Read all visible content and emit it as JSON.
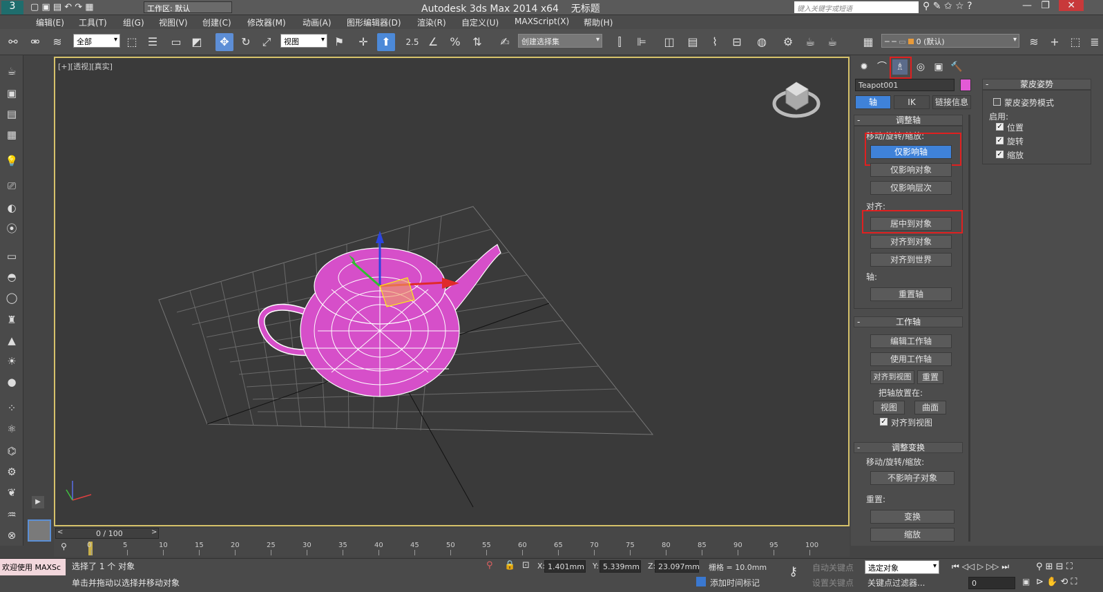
{
  "title": {
    "app": "Autodesk 3ds Max  2014 x64",
    "doc": "无标题",
    "workspace": "工作区: 默认",
    "search_placeholder": "键入关键字或短语"
  },
  "menu": [
    "编辑(E)",
    "工具(T)",
    "组(G)",
    "视图(V)",
    "创建(C)",
    "修改器(M)",
    "动画(A)",
    "图形编辑器(D)",
    "渲染(R)",
    "自定义(U)",
    "MAXScript(X)",
    "帮助(H)"
  ],
  "toolbar": {
    "filter": "全部",
    "refcoord": "视图",
    "snap_angle": "2.5",
    "named_sel": "创建选择集",
    "layer": "0 (默认)"
  },
  "viewport": {
    "label": "[+][透视][真实]"
  },
  "panel": {
    "object_name": "Teapot001",
    "object_color": "#e35ad6",
    "tabs": [
      "轴",
      "IK",
      "链接信息"
    ],
    "adjust_pivot": {
      "header": "调整轴",
      "move_label": "移动/旋转/缩放:",
      "affect_pivot": "仅影响轴",
      "affect_object": "仅影响对象",
      "affect_hierarchy": "仅影响层次",
      "align_label": "对齐:",
      "center_to_object": "居中到对象",
      "align_to_object": "对齐到对象",
      "align_to_world": "对齐到世界",
      "pivot_label": "轴:",
      "reset_pivot": "重置轴"
    },
    "working_pivot": {
      "header": "工作轴",
      "edit": "编辑工作轴",
      "use": "使用工作轴",
      "align_view": "对齐到视图",
      "reset": "重置",
      "place_label": "把轴放置在:",
      "view": "视图",
      "surface": "曲面",
      "align_to_view_chk": "对齐到视图"
    },
    "adjust_transform": {
      "header": "调整变换",
      "move_label": "移动/旋转/缩放:",
      "dont_affect_children": "不影响子对象",
      "reset_label": "重置:",
      "transform": "变换",
      "scale": "缩放"
    },
    "skin_pose": {
      "header": "蒙皮姿势",
      "mode": "蒙皮姿势模式",
      "enable_label": "启用:",
      "position": "位置",
      "rotation": "旋转",
      "scale": "缩放"
    }
  },
  "timeline": {
    "frame": "0 / 100",
    "ticks": [
      "0",
      "5",
      "10",
      "15",
      "20",
      "25",
      "30",
      "35",
      "40",
      "45",
      "50",
      "55",
      "60",
      "65",
      "70",
      "75",
      "80",
      "85",
      "90",
      "95",
      "100"
    ]
  },
  "status": {
    "welcome": "欢迎使用 MAXSc",
    "selected": "选择了 1 个 对象",
    "prompt": "单击并拖动以选择并移动对象",
    "x": "1.401mm",
    "y": "5.339mm",
    "z": "23.097mm",
    "grid": "栅格 = 10.0mm",
    "add_time_tag": "添加时间标记",
    "auto_key": "自动关键点",
    "set_key": "设置关键点",
    "sel_set": "选定对象",
    "key_filters": "关键点过滤器...",
    "frame_field": "0"
  }
}
